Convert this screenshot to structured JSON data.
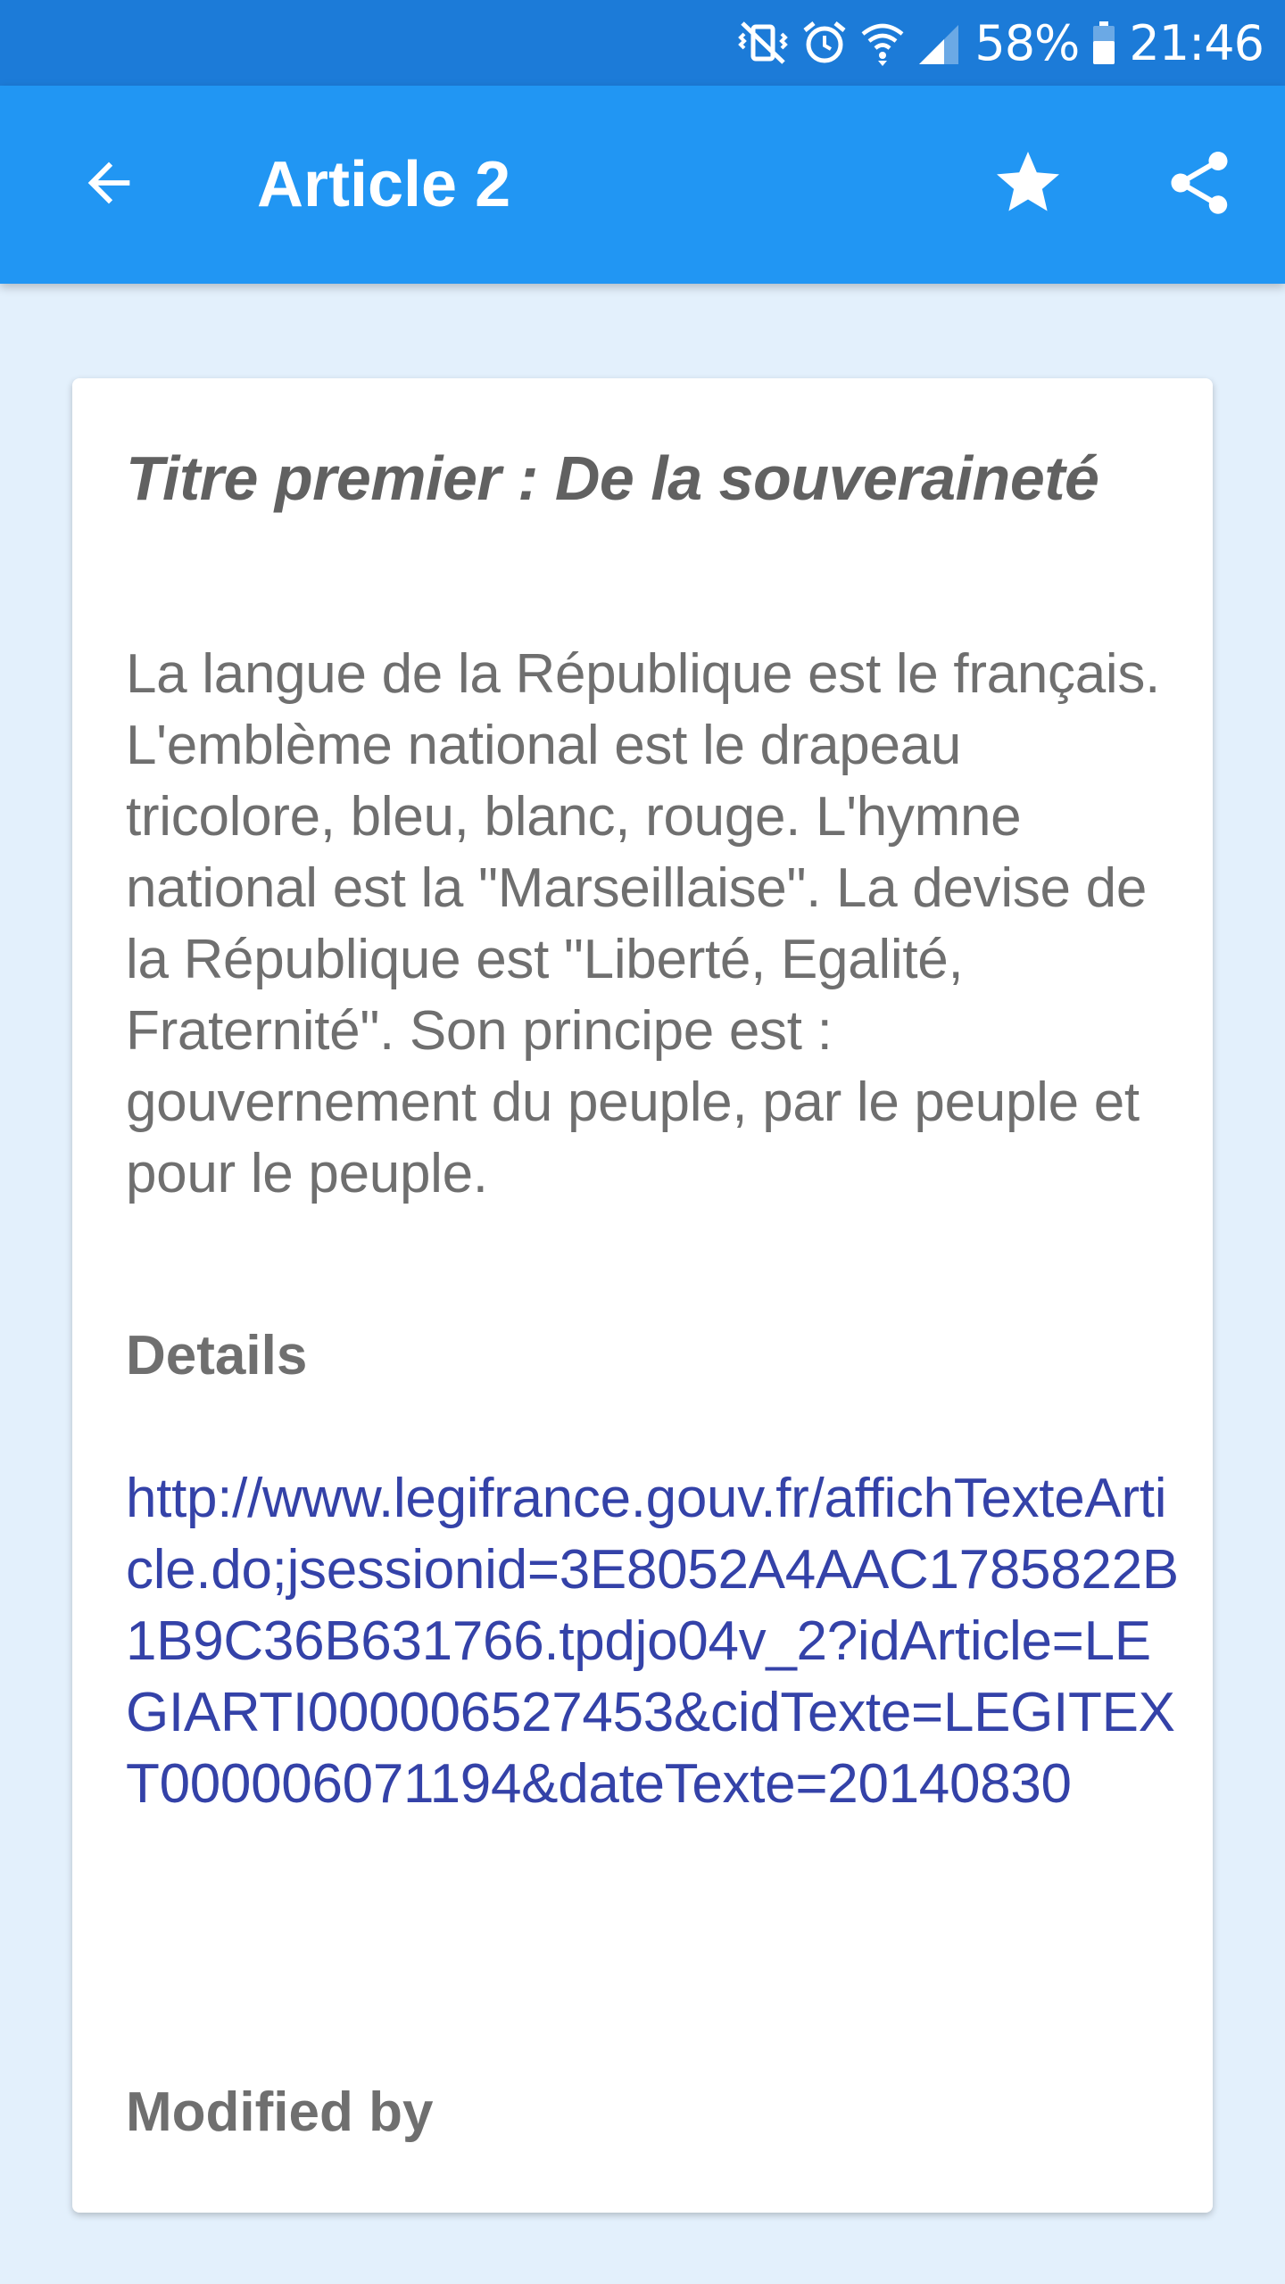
{
  "status_bar": {
    "battery": "58%",
    "time": "21:46",
    "icons": [
      "vibrate-mute-icon",
      "alarm-icon",
      "wifi-icon",
      "signal-icon",
      "battery-icon"
    ],
    "background": "#1c7bd8"
  },
  "app_bar": {
    "title": "Article 2",
    "background": "#2196f3",
    "back_icon": "arrow-back-icon",
    "favorite_icon": "star-icon",
    "share_icon": "share-icon"
  },
  "card": {
    "title": "Titre premier : De la souveraineté",
    "body": "La langue de la République est le français. L'emblème national est le drapeau tricolore, bleu, blanc, rouge. L'hymne national est la \"Marseillaise\". La devise de la République est \"Liberté, Egalité, Fraternité\". Son principe est : gouvernement du peuple, par le peuple et pour le peuple.",
    "details_label": "Details",
    "details_link": "http://www.legifrance.gouv.fr/affichTexteArticle.do;jsessionid=3E8052A4AAC1785822B1B9C36B631766.tpdjo04v_2?idArticle=LEGIARTI000006527453&cidTexte=LEGITEXT000006071194&dateTexte=20140830",
    "modified_label": "Modified by",
    "link_color": "#3442a8",
    "text_color": "#6f6f6f"
  },
  "page_background": "#e3f0fc"
}
